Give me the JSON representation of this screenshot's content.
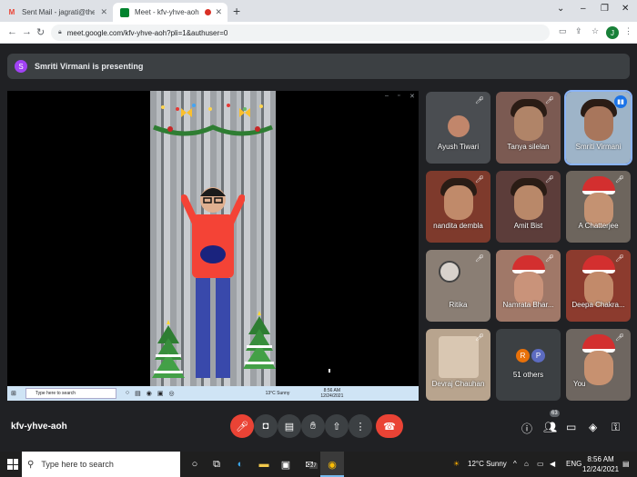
{
  "browser": {
    "tabs": [
      {
        "label": "Sent Mail - jagrati@theindiansch",
        "icon": "gmail-icon",
        "active": false
      },
      {
        "label": "Meet - kfv-yhve-aoh",
        "icon": "meet-icon",
        "active": true
      }
    ],
    "new_tab": "+",
    "url": "meet.google.com/kfv-yhve-aoh?pli=1&authuser=0",
    "profile_initial": "J",
    "window_controls": [
      "⌄",
      "–",
      "❐",
      "✕"
    ]
  },
  "meet": {
    "presenter_initial": "S",
    "presenting_text": "Smriti Virmani is presenting",
    "meeting_code": "kfv-yhve-aoh",
    "people_count": "63",
    "participants": [
      {
        "name": "Ayush Tiwari",
        "muted": true
      },
      {
        "name": "Tanya silelan",
        "muted": true
      },
      {
        "name": "Smriti Virmani",
        "muted": false,
        "speaking": true
      },
      {
        "name": "nandita dembla",
        "muted": true
      },
      {
        "name": "Amit Bist",
        "muted": true
      },
      {
        "name": "A Chatterjee",
        "muted": true
      },
      {
        "name": "Ritika",
        "muted": true
      },
      {
        "name": "Namrata Bhar...",
        "muted": true
      },
      {
        "name": "Deepa Chakra...",
        "muted": true
      },
      {
        "name": "Devraj Chauhan",
        "muted": true
      },
      {
        "name": "51 others",
        "avatars": [
          "R",
          "P"
        ]
      },
      {
        "name": "You",
        "muted": true
      }
    ]
  },
  "shared_screen": {
    "search_placeholder": "Type here to search",
    "weather": "13°C Sunny",
    "time": "8:56 AM",
    "date": "12/24/2021"
  },
  "taskbar": {
    "search_placeholder": "Type here to search",
    "weather": "12°C  Sunny",
    "language": "ENG",
    "time": "8:56 AM",
    "date": "12/24/2021",
    "badge_count": "27"
  },
  "colors": {
    "meet_bg": "#202124",
    "red_button": "#ea4335",
    "speaking_outline": "#8ab4f8",
    "mic_active": "#1a73e8"
  }
}
